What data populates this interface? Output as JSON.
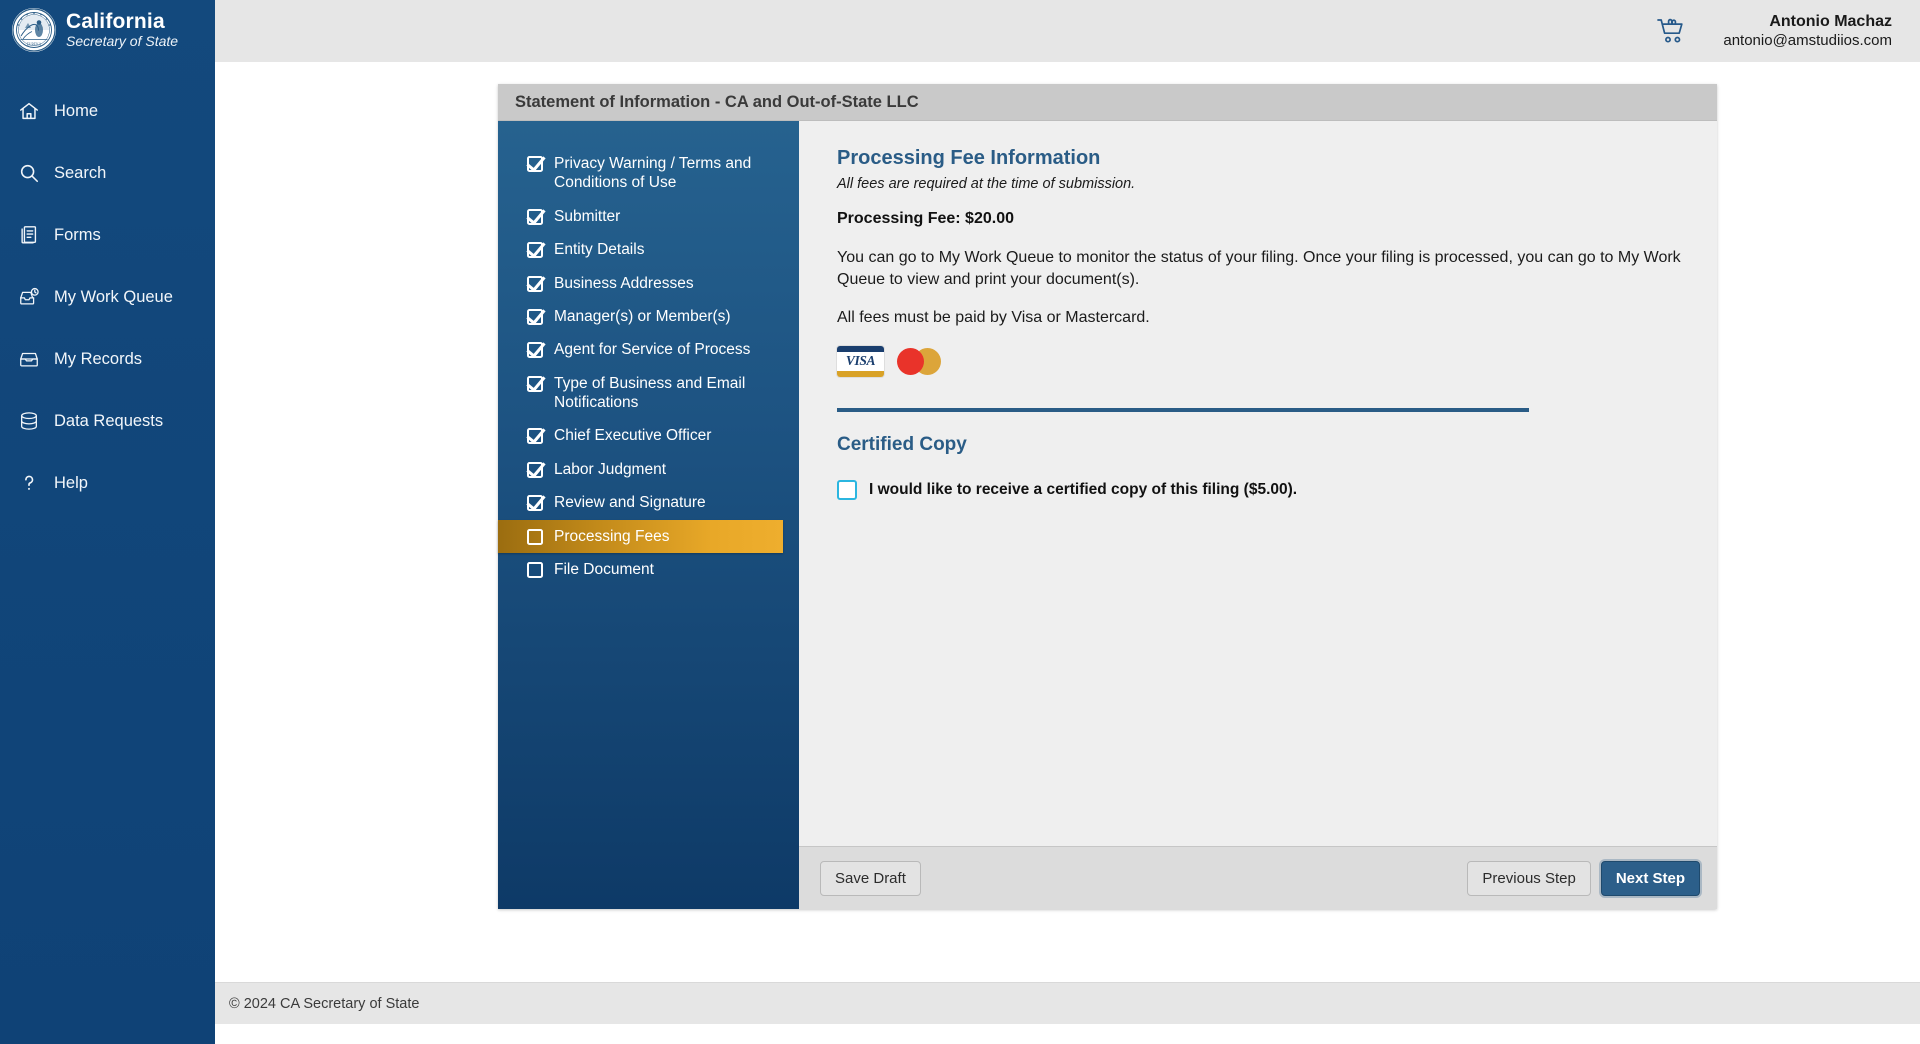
{
  "brand": {
    "seal_icon": "california-state-seal",
    "title": "California",
    "subtitle": "Secretary of State"
  },
  "sidebar": {
    "items": [
      {
        "label": "Home",
        "icon": "home-icon"
      },
      {
        "label": "Search",
        "icon": "search-icon"
      },
      {
        "label": "Forms",
        "icon": "forms-icon"
      },
      {
        "label": "My Work Queue",
        "icon": "work-queue-icon"
      },
      {
        "label": "My Records",
        "icon": "records-icon"
      },
      {
        "label": "Data Requests",
        "icon": "database-icon"
      },
      {
        "label": "Help",
        "icon": "help-icon"
      }
    ]
  },
  "topbar": {
    "cart_icon": "shopping-cart-icon",
    "user_name": "Antonio Machaz",
    "user_email": "antonio@amstudiios.com"
  },
  "card": {
    "title": "Statement of Information - CA and Out-of-State LLC"
  },
  "steps": [
    {
      "label": "Privacy Warning / Terms and Conditions of Use",
      "checked": true,
      "active": false
    },
    {
      "label": "Submitter",
      "checked": true,
      "active": false
    },
    {
      "label": "Entity Details",
      "checked": true,
      "active": false
    },
    {
      "label": "Business Addresses",
      "checked": true,
      "active": false
    },
    {
      "label": "Manager(s) or Member(s)",
      "checked": true,
      "active": false
    },
    {
      "label": "Agent for Service of Process",
      "checked": true,
      "active": false
    },
    {
      "label": "Type of Business and Email Notifications",
      "checked": true,
      "active": false
    },
    {
      "label": "Chief Executive Officer",
      "checked": true,
      "active": false
    },
    {
      "label": "Labor Judgment",
      "checked": true,
      "active": false
    },
    {
      "label": "Review and Signature",
      "checked": true,
      "active": false
    },
    {
      "label": "Processing Fees",
      "checked": false,
      "active": true
    },
    {
      "label": "File Document",
      "checked": false,
      "active": false
    }
  ],
  "main": {
    "heading": "Processing Fee Information",
    "subheading": "All fees are required at the time of submission.",
    "fee_line": "Processing Fee: $20.00",
    "paragraph_1": "You can go to My Work Queue to monitor the status of your filing. Once your filing is processed, you can go to My Work Queue to view and print your document(s).",
    "paragraph_2": "All fees must be paid by Visa or Mastercard.",
    "visa_label": "VISA",
    "visa_icon": "visa-card-icon",
    "mastercard_icon": "mastercard-card-icon",
    "certified_heading": "Certified Copy",
    "certified_checkbox_label": "I would like to receive a certified copy of this filing ($5.00).",
    "certified_checked": false
  },
  "actions": {
    "save_draft": "Save Draft",
    "previous_step": "Previous Step",
    "next_step": "Next Step"
  },
  "footer": {
    "copyright": "© 2024 CA Secretary of State"
  },
  "colors": {
    "sidebar_navy": "#13497d",
    "panel_blue": "#1d5382",
    "accent_gold": "#e8a828",
    "heading_blue": "#2a5c86",
    "primary_button": "#2c5f8a",
    "checkbox_cyan": "#2bb6e0"
  }
}
